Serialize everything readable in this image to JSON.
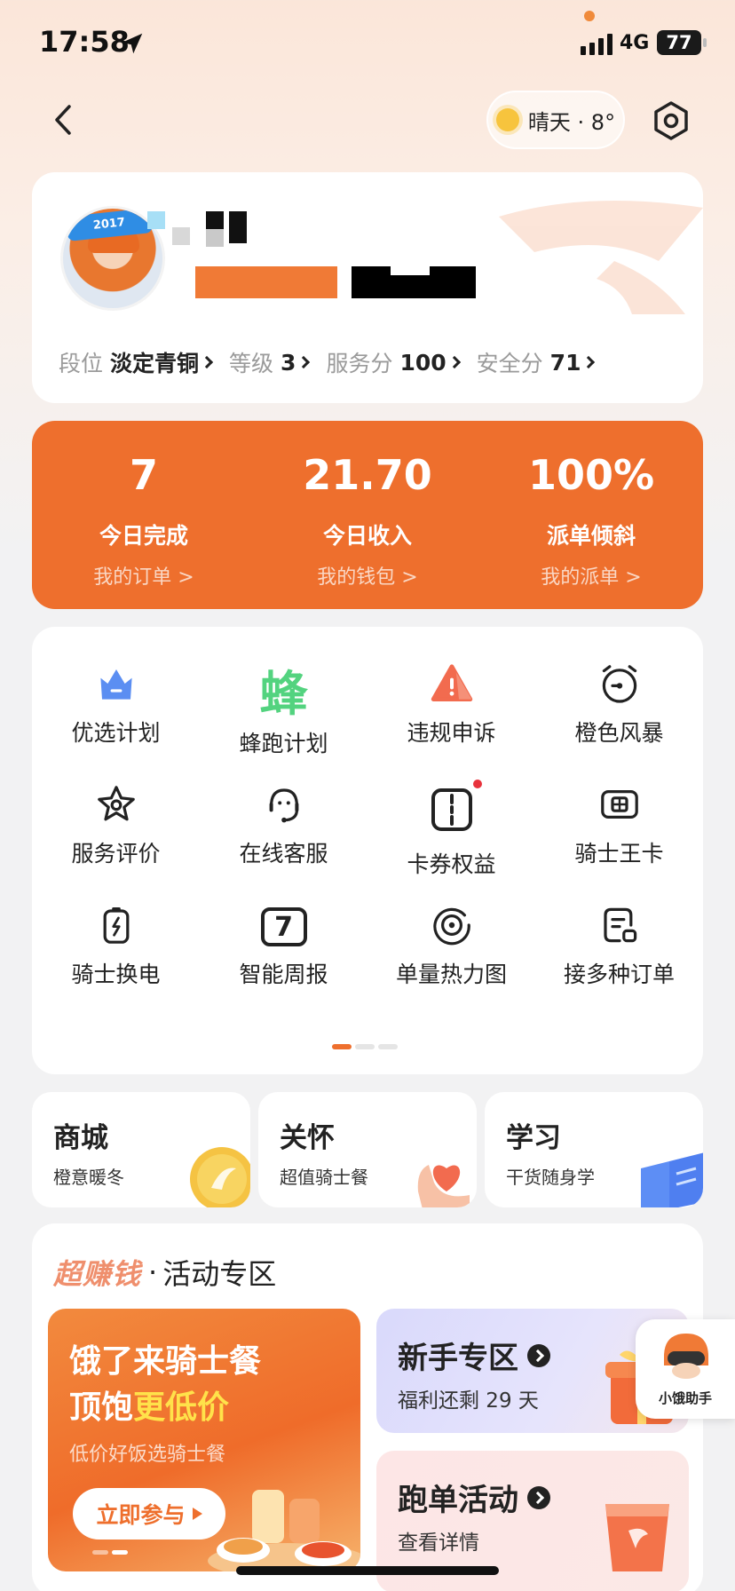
{
  "status_bar": {
    "time": "17:58",
    "network": "4G",
    "battery": "77"
  },
  "header": {
    "weather": "晴天 · 8°"
  },
  "profile": {
    "stats": [
      {
        "label": "段位",
        "value": "淡定青铜"
      },
      {
        "label": "等级",
        "value": "3"
      },
      {
        "label": "服务分",
        "value": "100"
      },
      {
        "label": "安全分",
        "value": "71"
      }
    ]
  },
  "summary": [
    {
      "value": "7",
      "label": "今日完成",
      "link": "我的订单 >"
    },
    {
      "value": "21.70",
      "label": "今日收入",
      "link": "我的钱包 >"
    },
    {
      "value": "100%",
      "label": "派单倾斜",
      "link": "我的派单 >"
    }
  ],
  "menu": [
    {
      "label": "优选计划",
      "icon": "crown-icon"
    },
    {
      "label": "蜂跑计划",
      "icon": "bee-char-icon",
      "glyph": "蜂"
    },
    {
      "label": "违规申诉",
      "icon": "warning-icon"
    },
    {
      "label": "橙色风暴",
      "icon": "alarm-clock-icon"
    },
    {
      "label": "服务评价",
      "icon": "star-icon"
    },
    {
      "label": "在线客服",
      "icon": "headset-icon"
    },
    {
      "label": "卡券权益",
      "icon": "coupon-icon",
      "badge": true
    },
    {
      "label": "骑士王卡",
      "icon": "card-icon"
    },
    {
      "label": "骑士换电",
      "icon": "battery-swap-icon"
    },
    {
      "label": "智能周报",
      "icon": "calendar-icon",
      "glyph": "7"
    },
    {
      "label": "单量热力图",
      "icon": "target-icon"
    },
    {
      "label": "接多种订单",
      "icon": "order-doc-icon"
    }
  ],
  "quick_cards": [
    {
      "title": "商城",
      "subtitle": "橙意暖冬",
      "icon": "coin-icon",
      "accent": "#f5c343"
    },
    {
      "title": "关怀",
      "subtitle": "超值骑士餐",
      "icon": "heart-hand-icon",
      "accent": "#f26b4f"
    },
    {
      "title": "学习",
      "subtitle": "干货随身学",
      "icon": "book-icon",
      "accent": "#4f7ff0"
    }
  ],
  "activity": {
    "brand": "超赚钱",
    "title": "活动专区",
    "promo": {
      "line1": "饿了来骑士餐",
      "line2_prefix": "顶饱",
      "line2_highlight": "更低价",
      "line3": "低价好饭选骑士餐",
      "button": "立即参与"
    },
    "cards": [
      {
        "title": "新手专区",
        "subtitle": "福利还剩 29 天"
      },
      {
        "title": "跑单活动",
        "subtitle": "查看详情"
      }
    ]
  },
  "assistant": {
    "label": "小饿助手"
  },
  "colors": {
    "brand_orange": "#ee6f2d",
    "highlight_yellow": "#ffe24a"
  }
}
